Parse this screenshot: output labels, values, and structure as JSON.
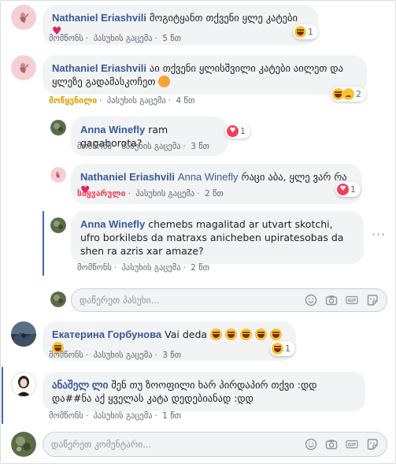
{
  "comments": [
    {
      "author": "Nathaniel Eriashvili",
      "text": "მოგიტყანთ თქვენი ყლე კატები",
      "actions": {
        "like": "მომწონს",
        "reply": "პასუხის გაცემა",
        "time": "5 წთ"
      },
      "reactions": {
        "count": "1"
      }
    },
    {
      "author": "Nathaniel Eriashvili",
      "text": "აი თქვენი ყლისშვილი კატები აილეთ და ყლეზე გადამასკოჩეთ",
      "actions": {
        "like": "მოწყენილი",
        "reply": "პასუხის გაცემა",
        "time": "4 წთ"
      },
      "reactions": {
        "count": "2"
      }
    },
    {
      "author": "Anna Winefly",
      "text": "ram gagaborota?",
      "actions": {
        "like": "მომწონს",
        "reply": "პასუხის გაცემა",
        "time": "3 წთ"
      },
      "reactions": {
        "count": "1"
      }
    },
    {
      "author": "Nathaniel Eriashvili",
      "tag": "Anna Winefly",
      "text": "რაცი აბა, ყლე ვარ რა",
      "actions": {
        "like": "სიყვარული",
        "reply": "პასუხის გაცემა",
        "time": "2 წთ"
      },
      "reactions": {
        "count": "1"
      }
    },
    {
      "author": "Anna Winefly",
      "text": "chemebs magalitad ar utvart skotchi, ufro borkilebs da matraxs anicheben upiratesobas da shen ra azris xar amaze?",
      "actions": {
        "like": "მომწონს",
        "reply": "პასუხის გაცემა",
        "time": "2 წთ"
      }
    },
    {
      "author": "Екатерина Горбунова",
      "text": "Vai deda",
      "actions": {
        "like": "მომწონს",
        "reply": "პასუხის გაცემა",
        "time": "3 წთ"
      },
      "reactions": {
        "count": "1"
      }
    },
    {
      "author": "ანაშელ ლი",
      "text": "შენ თუ ზოოფილი ხარ პირდაპირ თქვი :დდ და##ნა აქ ყველას კატა დედებიანად :დდ",
      "actions": {
        "like": "მომწონს",
        "reply": "პასუხის გაცემა",
        "time": "1 წთ"
      }
    }
  ],
  "reply_input": {
    "placeholder": "დაწერეთ პასუხი..."
  },
  "comment_input": {
    "placeholder": "დაწერეთ კომენტარი..."
  },
  "icons": [
    "smile-icon",
    "camera-icon",
    "gif-icon",
    "sticker-icon"
  ],
  "colors": {
    "name_blue": "#385898",
    "bubble_bg": "#f2f3f5",
    "sad_yellow": "#e0a100",
    "love_red": "#f33e58"
  }
}
